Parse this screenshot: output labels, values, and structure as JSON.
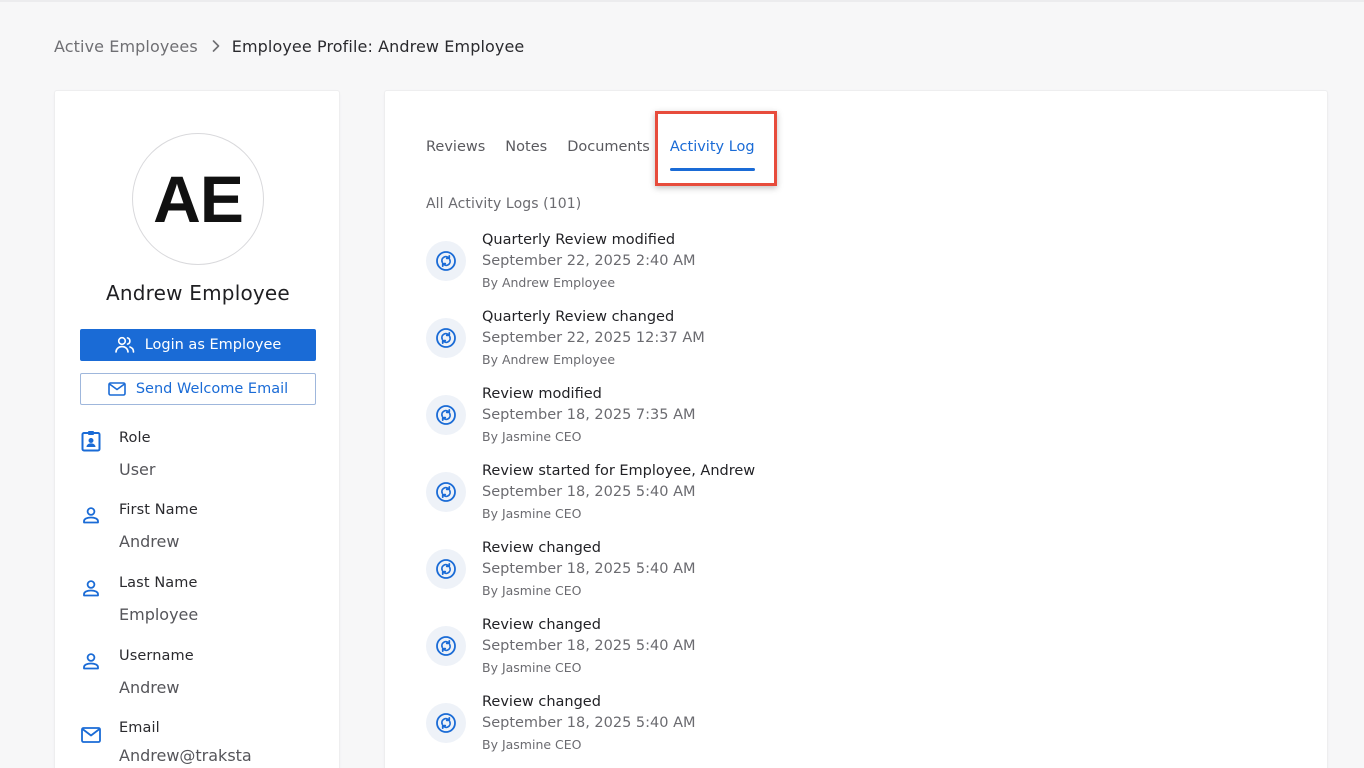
{
  "breadcrumb": {
    "parent": "Active Employees",
    "current": "Employee Profile: Andrew Employee"
  },
  "profile": {
    "initials": "AE",
    "name": "Andrew Employee",
    "login_button": "Login as Employee",
    "welcome_button": "Send Welcome Email",
    "fields": [
      {
        "label": "Role",
        "value": "User",
        "icon": "badge-icon"
      },
      {
        "label": "First Name",
        "value": "Andrew",
        "icon": "person-icon"
      },
      {
        "label": "Last Name",
        "value": "Employee",
        "icon": "person-icon"
      },
      {
        "label": "Username",
        "value": "Andrew",
        "icon": "person-icon"
      },
      {
        "label": "Email",
        "value": "Andrew@traksta",
        "icon": "mail-icon"
      }
    ]
  },
  "tabs": [
    {
      "label": "Reviews",
      "active": false
    },
    {
      "label": "Notes",
      "active": false
    },
    {
      "label": "Documents",
      "active": false
    },
    {
      "label": "Activity Log",
      "active": true
    }
  ],
  "activity": {
    "count_label": "All Activity Logs (101)",
    "entries": [
      {
        "title": "Quarterly Review modified",
        "date": "September 22, 2025 2:40 AM",
        "by": "By Andrew Employee"
      },
      {
        "title": "Quarterly Review changed",
        "date": "September 22, 2025 12:37 AM",
        "by": "By Andrew Employee"
      },
      {
        "title": "Review modified",
        "date": "September 18, 2025 7:35 AM",
        "by": "By Jasmine CEO"
      },
      {
        "title": "Review started for Employee, Andrew",
        "date": "September 18, 2025 5:40 AM",
        "by": "By Jasmine CEO"
      },
      {
        "title": "Review changed",
        "date": "September 18, 2025 5:40 AM",
        "by": "By Jasmine CEO"
      },
      {
        "title": "Review changed",
        "date": "September 18, 2025 5:40 AM",
        "by": "By Jasmine CEO"
      },
      {
        "title": "Review changed",
        "date": "September 18, 2025 5:40 AM",
        "by": "By Jasmine CEO"
      }
    ]
  },
  "colors": {
    "accent": "#1a6bd6",
    "highlight": "#e74c3c",
    "icon_bg": "#eef2f8"
  }
}
